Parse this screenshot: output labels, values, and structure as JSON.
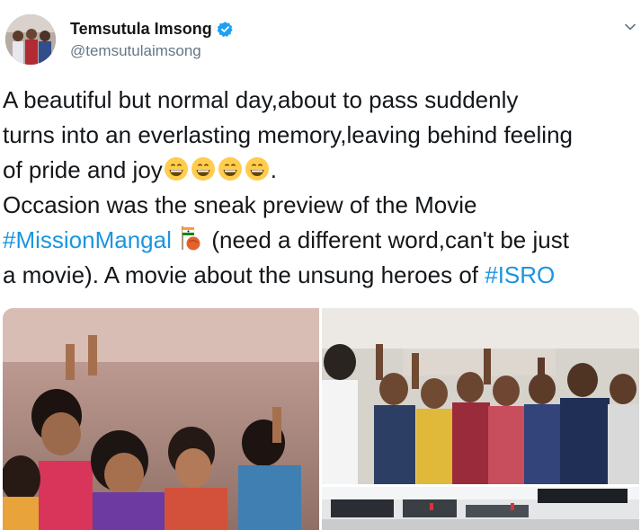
{
  "user": {
    "display_name": "Temsutula Imsong",
    "handle": "@temsutulaimsong",
    "verified": true,
    "avatar_icon": "profile-photo"
  },
  "tweet": {
    "line1": "A beautiful but normal day,about to pass suddenly",
    "line2": "turns into an everlasting memory,leaving behind feeling",
    "line3_text": "of pride and joy",
    "line3_emoji": "grinning-face-with-smiling-eyes",
    "line3_emoji_count": 4,
    "line3_end": ".",
    "line4": "Occasion was the sneak preview of the Movie",
    "line5_hashtag": "#MissionMangal",
    "line5_emoji": "flag-and-mars-icon",
    "line5_text": " (need a different word,can't be just",
    "line6_text": "a movie).  A movie about the unsung heroes of ",
    "line6_hashtag": "#ISRO"
  },
  "media": {
    "photo_count": 3,
    "photos": [
      "celebrating-women-scientists",
      "team-victory-group",
      "mission-control-room"
    ]
  },
  "colors": {
    "text": "#14171a",
    "secondary": "#657786",
    "link": "#1b95e0",
    "verified": "#1da1f2"
  }
}
